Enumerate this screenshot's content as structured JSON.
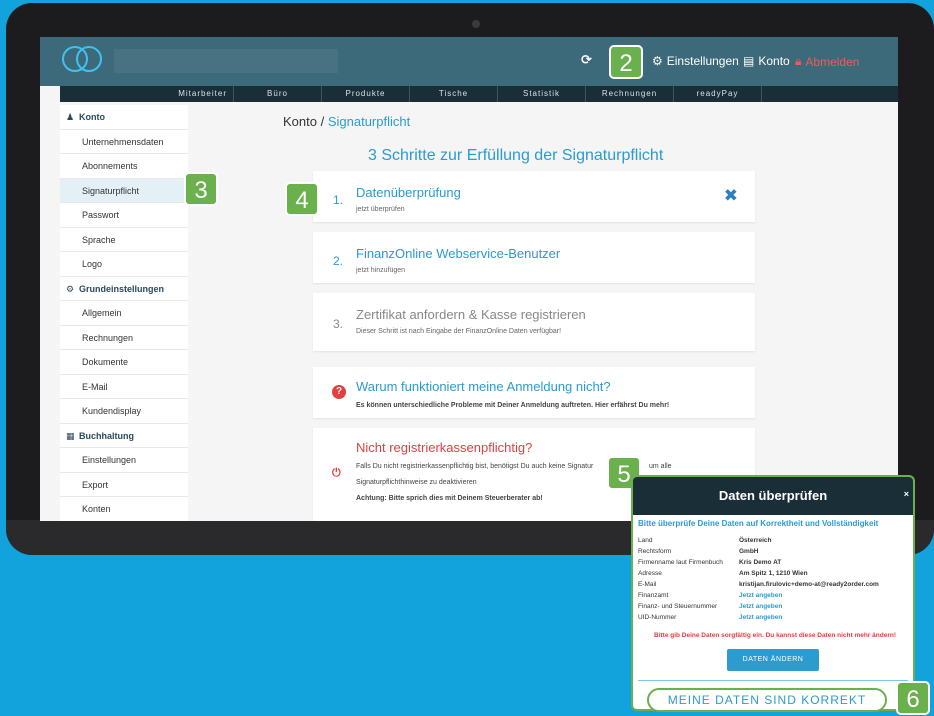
{
  "header": {
    "refresh_icon": "refresh-icon",
    "settings_label": "Einstellungen",
    "account_label": "Konto",
    "logout_label": "Abmelden"
  },
  "nav": {
    "items": [
      "Mitarbeiter",
      "Büro",
      "Produkte",
      "Tische",
      "Statistik",
      "Rechnungen",
      "readyPay"
    ]
  },
  "sidebar": {
    "konto_header": "Konto",
    "konto_items": [
      "Unternehmensdaten",
      "Abonnements",
      "Signaturpflicht",
      "Passwort",
      "Sprache",
      "Logo"
    ],
    "grund_header": "Grundeinstellungen",
    "grund_items": [
      "Allgemein",
      "Rechnungen",
      "Dokumente",
      "E-Mail",
      "Kundendisplay"
    ],
    "buch_header": "Buchhaltung",
    "buch_items": [
      "Einstellungen",
      "Export",
      "Konten"
    ]
  },
  "breadcrumb": {
    "root": "Konto",
    "sep": " / ",
    "current": "Signaturpflicht"
  },
  "main_title": "3 Schritte zur Erfüllung der Signaturpflicht",
  "steps": [
    {
      "num": "1.",
      "title": "Datenüberprüfung",
      "sub": "jetzt überprüfen"
    },
    {
      "num": "2.",
      "title": "FinanzOnline Webservice-Benutzer",
      "sub": "jetzt hinzufügen"
    },
    {
      "num": "3.",
      "title": "Zertifikat anfordern & Kasse registrieren",
      "sub": "Dieser Schritt ist nach Eingabe der FinanzOnline Daten verfügbar!"
    }
  ],
  "help_box": {
    "title": "Warum funktioniert meine Anmeldung nicht?",
    "sub": "Es können unterschiedliche Probleme mit Deiner Anmeldung auftreten. Hier erfährst Du mehr!"
  },
  "not_required_box": {
    "title": "Nicht registrierkassenpflichtig?",
    "line1": "Falls Du nicht registrierkassenpflichtig bist, benötigst Du auch keine Signatur",
    "line1b": "um alle",
    "line2": "Signaturpflichthinweise zu deaktivieren",
    "line3": "Achtung: Bitte sprich dies mit Deinem Steuerberater ab!"
  },
  "badges": [
    "2",
    "3",
    "4",
    "5",
    "6"
  ],
  "modal": {
    "title": "Daten überprüfen",
    "close": "×",
    "subtitle": "Bitte überprüfe Deine Daten auf Korrektheit und Vollständigkeit",
    "rows": [
      {
        "key": "Land",
        "value": "Österreich"
      },
      {
        "key": "Rechtsform",
        "value": "GmbH"
      },
      {
        "key": "Firmenname laut Firmenbuch",
        "value": "Kris Demo AT"
      },
      {
        "key": "Adresse",
        "value": "Am Spitz 1, 1210 Wien"
      },
      {
        "key": "E-Mail",
        "value": "kristijan.firulovic+demo-at@ready2order.com"
      },
      {
        "key": "Finanzamt",
        "value": "Jetzt angeben"
      },
      {
        "key": "Finanz- und Steuernummer",
        "value": "Jetzt angeben"
      },
      {
        "key": "UID-Nummer",
        "value": "Jetzt angeben"
      }
    ],
    "warning": "Bitte gib Deine Daten sorgfältig ein. Du kannst diese Daten nicht mehr ändern!",
    "change_button": "DATEN ÄNDERN",
    "confirm_button": "MEINE DATEN SIND KORREKT"
  },
  "colors": {
    "accent": "#2b9bd0",
    "header": "#3d6a7a",
    "nav": "#1a2e37",
    "badge": "#6ab04c",
    "danger": "#e04040"
  }
}
